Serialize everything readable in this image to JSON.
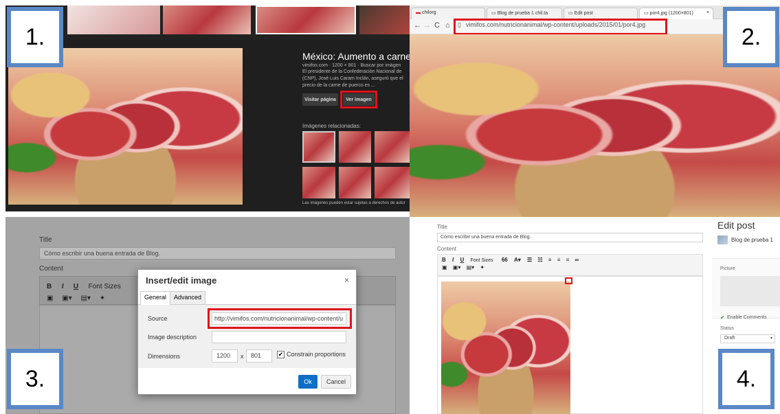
{
  "step_labels": [
    "1.",
    "2.",
    "3.",
    "4."
  ],
  "panel1": {
    "title": "México: Aumento a carne de",
    "meta": "vimifos.com · 1200 × 801 · Buscar por imágen",
    "desc_line1": "El presidente de la Confederación Nacional de",
    "desc_line2": "(CNP), José Luis Caram Inclán, aseguró que el",
    "desc_line3": "precio de la carne de puerco es ...",
    "visit_button": "Visitar página",
    "view_button": "Ver imagen",
    "related_heading": "Imágenes relacionadas:",
    "footer_note": "Las imágenes pueden estar sujetas a derechos de autor"
  },
  "panel2": {
    "tabs": [
      "chilorg",
      "Blog de prueba 1 chil.ta",
      "Edit post",
      "por4.jpg (1200×801)"
    ],
    "url": "vimifos.com/nutricionanimal/wp-content/uploads/2015/01/por4.jpg"
  },
  "panel3": {
    "title_label": "Title",
    "title_value": "Cómo escribir una buena entrada de Blog.",
    "content_label": "Content",
    "toolbar": {
      "bold": "B",
      "italic": "I",
      "underline": "U",
      "font_sizes": "Font Sizes"
    },
    "dialog": {
      "title": "Insert/edit image",
      "close": "×",
      "tab_general": "General",
      "tab_advanced": "Advanced",
      "source_label": "Source",
      "source_value": "http://vimifos.com/nutricionanimal/wp-content/u",
      "description_label": "Image description",
      "dimensions_label": "Dimensions",
      "width": "1200",
      "times": "x",
      "height": "801",
      "constrain_label": "Constrain proportions",
      "ok_button": "Ok",
      "cancel_button": "Cancel"
    }
  },
  "panel4": {
    "title_label": "Title",
    "title_value": "Cómo escribir una buena entrada de Blog.",
    "content_label": "Content",
    "toolbar": {
      "bold": "B",
      "italic": "I",
      "underline": "U",
      "font_sizes": "Font Sizes",
      "quote": "66"
    },
    "edit_post_heading": "Edit post",
    "blog_name": "Blog de prueba 1",
    "picture_label": "Picture",
    "enable_comments": "Enable Comments",
    "status_label": "Status",
    "status_value": "Draft"
  },
  "colors": {
    "highlight_red": "#e0121b",
    "label_blue": "#5a88c6",
    "ok_blue": "#0f6fc6"
  }
}
